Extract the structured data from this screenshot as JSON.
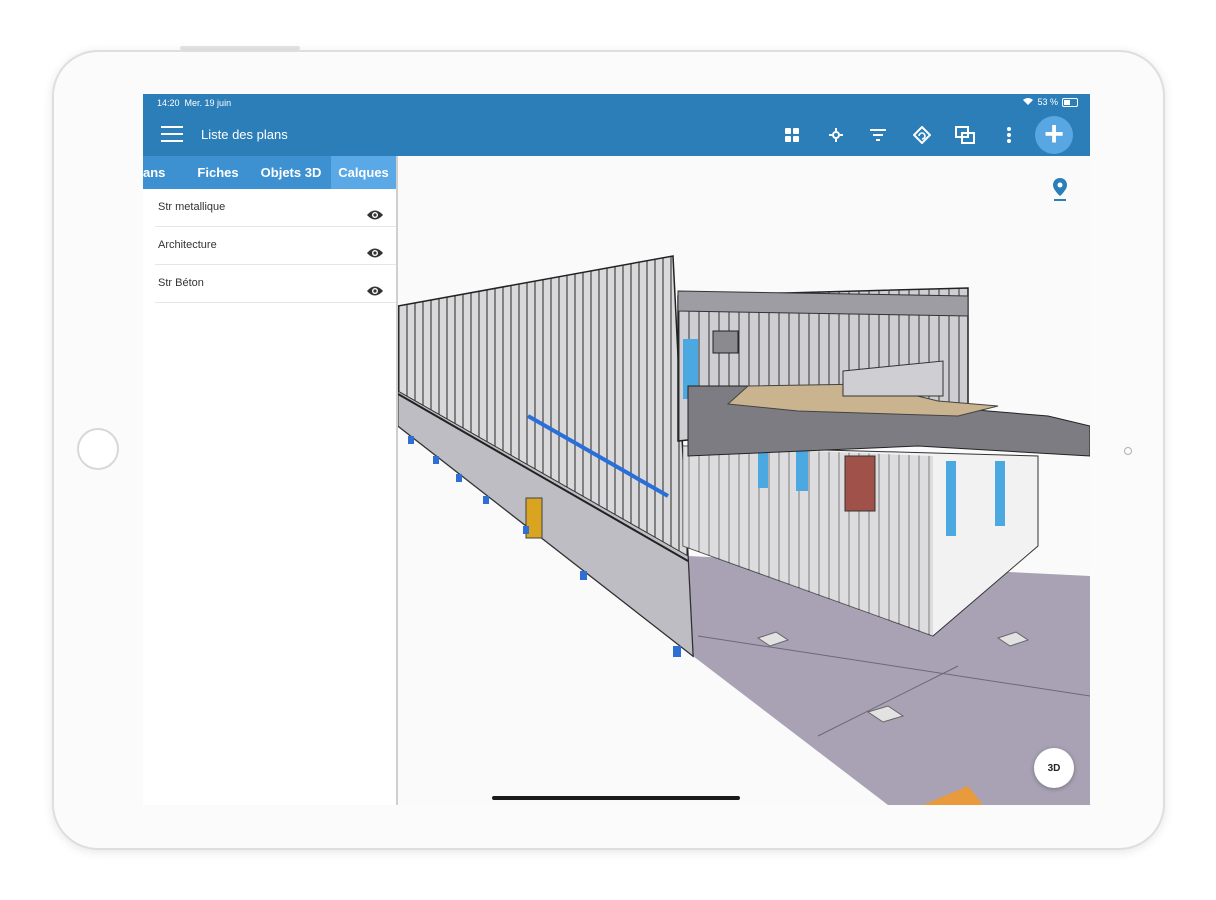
{
  "status_bar": {
    "time": "14:20",
    "date": "Mer. 19 juin",
    "battery": "53 %"
  },
  "header": {
    "title": "Liste des plans"
  },
  "toolbar": {
    "icons": [
      "grid-icon",
      "target-icon",
      "filter-icon",
      "rotate-icon",
      "layers-icon",
      "more-vertical-icon"
    ],
    "add_icon": "+"
  },
  "tabs": [
    {
      "label": "ans",
      "active": false
    },
    {
      "label": "Fiches",
      "active": false
    },
    {
      "label": "Objets 3D",
      "active": false
    },
    {
      "label": "Calques",
      "active": true
    }
  ],
  "layers": [
    {
      "label": "Str metallique",
      "visible": true
    },
    {
      "label": "Architecture",
      "visible": true
    },
    {
      "label": "Str Béton",
      "visible": true
    }
  ],
  "viewer": {
    "view_button": "3D"
  },
  "colors": {
    "accent": "#2b7eb7",
    "tab_bar": "#3d91d1",
    "active_tab": "#5aa9e6",
    "fab": "#58a7e2",
    "floor": "#a8a2b4"
  }
}
